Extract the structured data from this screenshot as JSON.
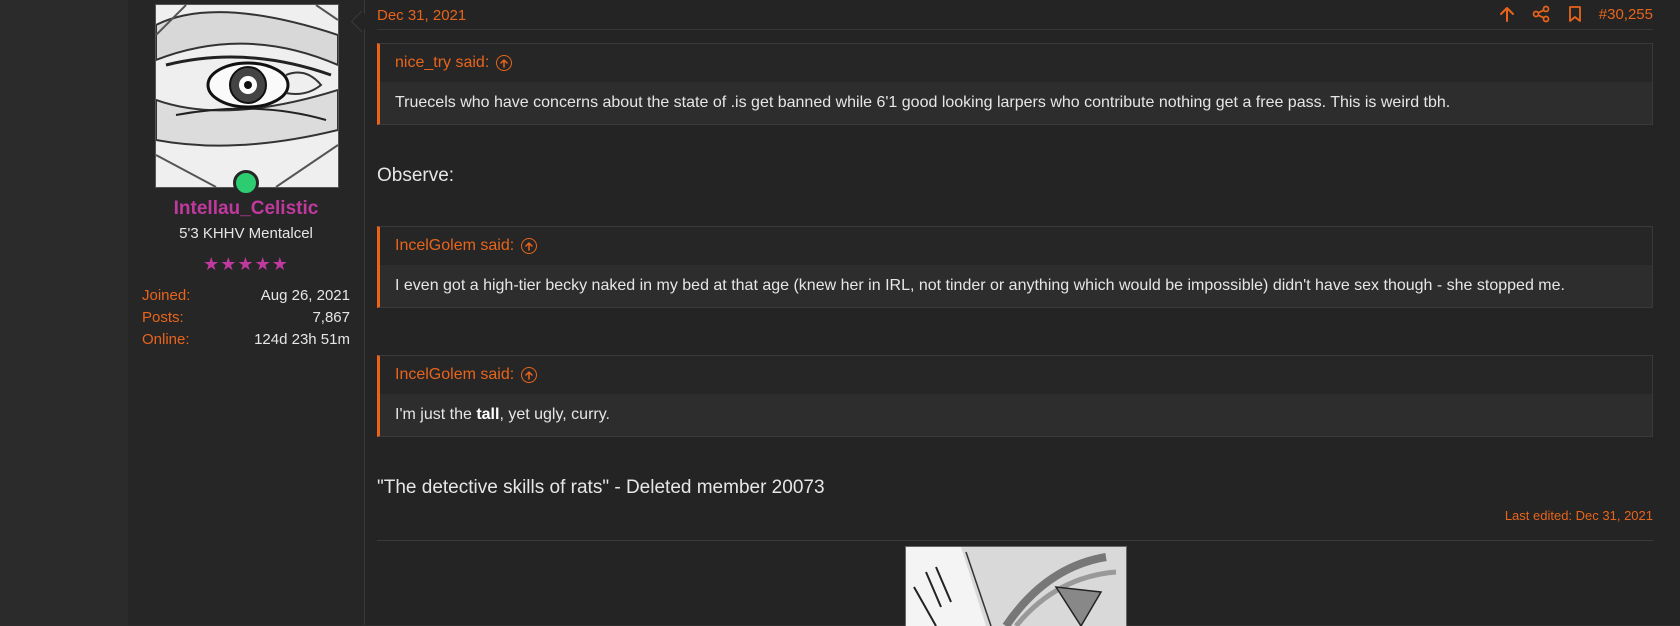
{
  "post": {
    "date": "Dec 31, 2021",
    "number": "#30,255",
    "actions": [
      {
        "icon": "arrow-up-icon"
      },
      {
        "icon": "share-icon"
      },
      {
        "icon": "bookmark-icon"
      }
    ]
  },
  "user": {
    "name": "Intellau_Celistic",
    "title": "5'3 KHHV Mentalcel",
    "stars": "★★★★★",
    "stats": [
      {
        "label": "Joined:",
        "value": "Aug 26, 2021"
      },
      {
        "label": "Posts:",
        "value": "7,867"
      },
      {
        "label": "Online:",
        "value": "124d 23h 51m"
      }
    ]
  },
  "quotes": [
    {
      "author": "nice_try said:",
      "text": "Truecels who have concerns about the state of .is get banned while 6'1 good looking larpers who contribute nothing get a free pass. This is weird tbh."
    },
    {
      "author": "IncelGolem said:",
      "text": "I even got a high-tier becky naked in my bed at that age (knew her in IRL, not tinder or anything which would be impossible) didn't have sex though - she stopped me."
    },
    {
      "author": "IncelGolem said:",
      "text_before": "I'm just the ",
      "text_bold": "tall",
      "text_after": ", yet ugly, curry."
    }
  ],
  "body": {
    "observe": "Observe:",
    "signature_quote": "\"The detective skills of rats\" - Deleted member 20073",
    "last_edited": "Last edited: Dec 31, 2021"
  },
  "colors": {
    "accent": "#e8641b",
    "username": "#c0399e",
    "online": "#2ecc71",
    "background": "#242424"
  }
}
